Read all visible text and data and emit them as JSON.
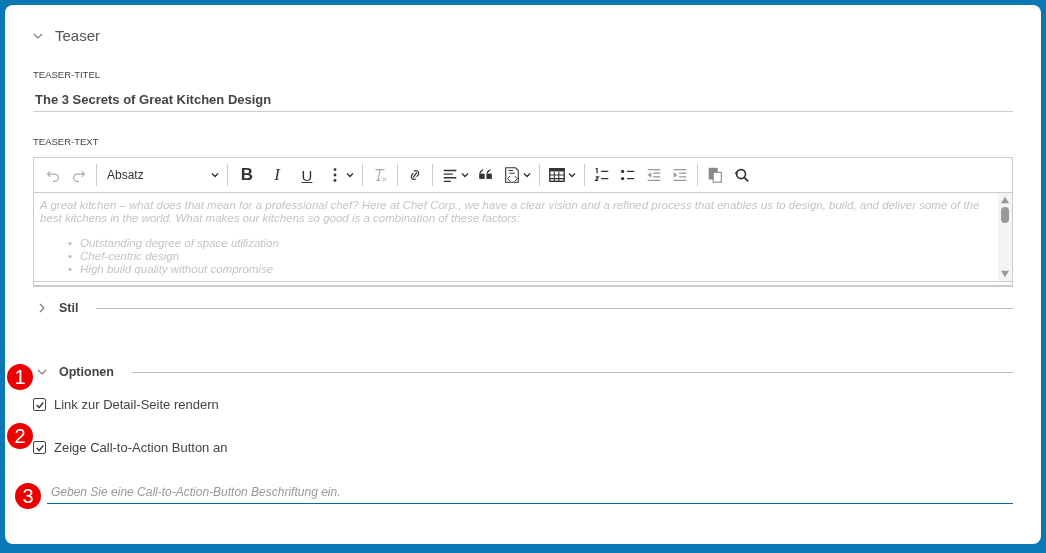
{
  "section": {
    "title": "Teaser",
    "expanded": true
  },
  "title_field": {
    "label": "TEASER-TITEL",
    "value": "The 3 Secrets of Great Kitchen Design"
  },
  "text_field": {
    "label": "TEASER-TEXT",
    "toolbar": [
      {
        "kind": "undo"
      },
      {
        "kind": "redo"
      },
      {
        "kind": "sep"
      },
      {
        "kind": "select",
        "label": "Absatz"
      },
      {
        "kind": "sep"
      },
      {
        "kind": "bold",
        "label": "B"
      },
      {
        "kind": "italic",
        "label": "I"
      },
      {
        "kind": "underline",
        "label": "U"
      },
      {
        "kind": "more"
      },
      {
        "kind": "sep"
      },
      {
        "kind": "clear"
      },
      {
        "kind": "sep"
      },
      {
        "kind": "link"
      },
      {
        "kind": "sep"
      },
      {
        "kind": "align"
      },
      {
        "kind": "quote"
      },
      {
        "kind": "source"
      },
      {
        "kind": "sep"
      },
      {
        "kind": "table"
      },
      {
        "kind": "sep"
      },
      {
        "kind": "numbered"
      },
      {
        "kind": "bulleted"
      },
      {
        "kind": "outdent"
      },
      {
        "kind": "indent"
      },
      {
        "kind": "sep"
      },
      {
        "kind": "paste"
      },
      {
        "kind": "find"
      }
    ],
    "paragraph": "A great kitchen – what does that mean for a professional chef? Here at Chef Corp., we have a clear vision and a refined process that enables us to design, build, and deliver some of the best kitchens in the world. What makes our kitchens so good is a combination of these factors:",
    "bullets": [
      {
        "marker": "•",
        "text": "Outstanding degree of space utilization"
      },
      {
        "marker": "•",
        "text": "Chef-centric design"
      },
      {
        "marker": "•",
        "text": "High build quality without compromise"
      }
    ]
  },
  "groups": [
    {
      "title": "Stil",
      "expanded": false
    },
    {
      "title": "Optionen",
      "expanded": true
    }
  ],
  "options": [
    {
      "label": "Link zur Detail-Seite rendern",
      "checked": true
    },
    {
      "label": "Zeige Call-to-Action Button an",
      "checked": true
    }
  ],
  "cta_field": {
    "placeholder": "Geben Sie eine Call-to-Action-Button Beschriftung ein."
  },
  "callouts": [
    "1",
    "2",
    "3"
  ]
}
